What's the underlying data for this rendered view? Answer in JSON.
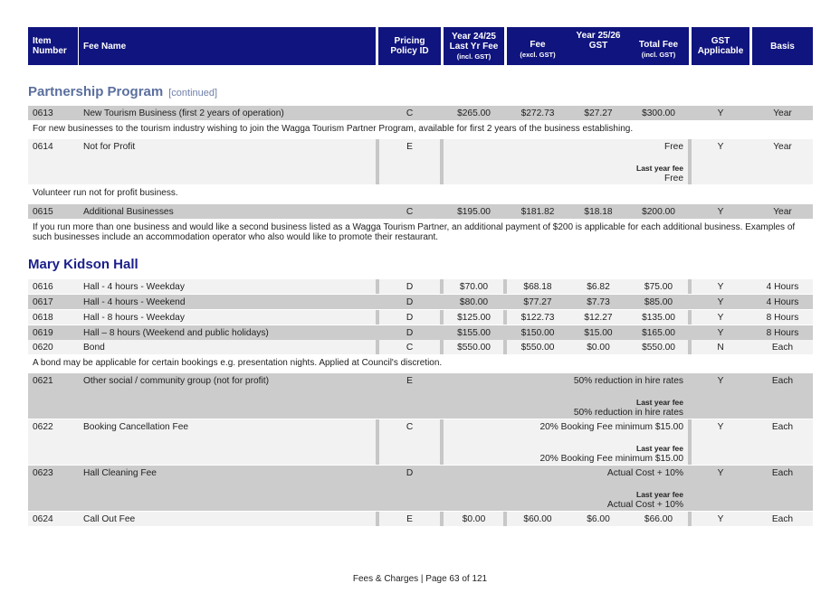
{
  "header": {
    "item_number": "Item Number",
    "fee_name": "Fee Name",
    "pricing_policy": "Pricing Policy ID",
    "year_2425": "Year 24/25",
    "last_yr_fee": "Last Yr Fee",
    "incl_gst": "(incl. GST)",
    "fee": "Fee",
    "excl_gst": "(excl. GST)",
    "year_2526": "Year 25/26",
    "gst": "GST",
    "total_fee": "Total Fee",
    "incl_gst2": "(incl. GST)",
    "gst_applicable": "GST Applicable",
    "basis": "Basis"
  },
  "sections": {
    "partnership": {
      "title": "Partnership Program",
      "continued": "[continued]"
    },
    "mary": {
      "title": "Mary Kidson Hall"
    }
  },
  "rows": {
    "r0613": {
      "item": "0613",
      "name": "New Tourism Business (first 2 years of operation)",
      "policy": "C",
      "last": "$265.00",
      "fee": "$272.73",
      "gst": "$27.27",
      "total": "$300.00",
      "gst_app": "Y",
      "basis": "Year"
    },
    "n0613": "For new businesses to the tourism industry wishing to join the Wagga Tourism Partner Program, available for first 2 years of the business establishing.",
    "r0614": {
      "item": "0614",
      "name": "Not for Profit",
      "policy": "E",
      "text": "Free",
      "last_label": "Last year fee",
      "last_text": "Free",
      "gst_app": "Y",
      "basis": "Year"
    },
    "n0614": "Volunteer run not for profit business.",
    "r0615": {
      "item": "0615",
      "name": "Additional Businesses",
      "policy": "C",
      "last": "$195.00",
      "fee": "$181.82",
      "gst": "$18.18",
      "total": "$200.00",
      "gst_app": "Y",
      "basis": "Year"
    },
    "n0615": "If you run more than one business and would like a second business listed as a Wagga Tourism Partner, an additional payment of $200 is applicable for each additional business. Examples of such businesses include an accommodation operator who also would like to promote their restaurant.",
    "r0616": {
      "item": "0616",
      "name": "Hall - 4 hours - Weekday",
      "policy": "D",
      "last": "$70.00",
      "fee": "$68.18",
      "gst": "$6.82",
      "total": "$75.00",
      "gst_app": "Y",
      "basis": "4 Hours"
    },
    "r0617": {
      "item": "0617",
      "name": "Hall - 4 hours - Weekend",
      "policy": "D",
      "last": "$80.00",
      "fee": "$77.27",
      "gst": "$7.73",
      "total": "$85.00",
      "gst_app": "Y",
      "basis": "4 Hours"
    },
    "r0618": {
      "item": "0618",
      "name": "Hall - 8 hours - Weekday",
      "policy": "D",
      "last": "$125.00",
      "fee": "$122.73",
      "gst": "$12.27",
      "total": "$135.00",
      "gst_app": "Y",
      "basis": "8 Hours"
    },
    "r0619": {
      "item": "0619",
      "name": "Hall – 8 hours (Weekend and public holidays)",
      "policy": "D",
      "last": "$155.00",
      "fee": "$150.00",
      "gst": "$15.00",
      "total": "$165.00",
      "gst_app": "Y",
      "basis": "8 Hours"
    },
    "r0620": {
      "item": "0620",
      "name": "Bond",
      "policy": "C",
      "last": "$550.00",
      "fee": "$550.00",
      "gst": "$0.00",
      "total": "$550.00",
      "gst_app": "N",
      "basis": "Each"
    },
    "n0620": "A bond may be applicable for certain bookings e.g. presentation nights. Applied at Council's discretion.",
    "r0621": {
      "item": "0621",
      "name": "Other social / community group (not for profit)",
      "policy": "E",
      "text": "50% reduction in hire rates",
      "last_label": "Last year fee",
      "last_text": "50% reduction in hire rates",
      "gst_app": "Y",
      "basis": "Each"
    },
    "r0622": {
      "item": "0622",
      "name": "Booking Cancellation Fee",
      "policy": "C",
      "text": "20% Booking Fee minimum $15.00",
      "last_label": "Last year fee",
      "last_text": "20% Booking Fee minimum $15.00",
      "gst_app": "Y",
      "basis": "Each"
    },
    "r0623": {
      "item": "0623",
      "name": "Hall Cleaning Fee",
      "policy": "D",
      "text": "Actual Cost + 10%",
      "last_label": "Last year fee",
      "last_text": "Actual Cost + 10%",
      "gst_app": "Y",
      "basis": "Each"
    },
    "r0624": {
      "item": "0624",
      "name": "Call Out Fee",
      "policy": "E",
      "last": "$0.00",
      "fee": "$60.00",
      "gst": "$6.00",
      "total": "$66.00",
      "gst_app": "Y",
      "basis": "Each"
    }
  },
  "footer": "Fees & Charges | Page 63 of 121",
  "colors": {
    "header_bg": "#10147e",
    "section_title_1": "#5b6f9e",
    "section_title_2": "#1a1f8a",
    "row_dark": "#cccccc",
    "row_light": "#f2f2f2",
    "separator": "#c7c7c7"
  }
}
